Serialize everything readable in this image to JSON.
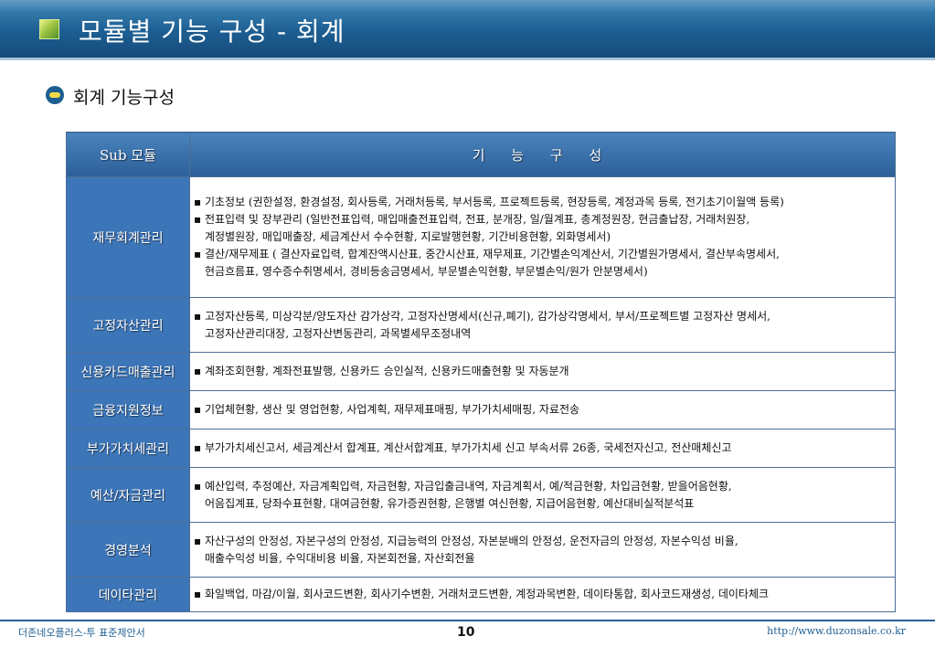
{
  "header": {
    "title": "모듈별 기능 구성 - 회계",
    "icon": "green-square-icon"
  },
  "section": {
    "title": "회계 기능구성",
    "bullet_icon": "oval-bullet-icon"
  },
  "table": {
    "col_module": "Sub 모듈",
    "col_features": "기 능 구 성",
    "rows": [
      {
        "module": "재무회계관리",
        "lines": [
          "▪ 기초정보 (권한설정, 환경설정, 회사등록, 거래처등록, 부서등록, 프로젝트등록, 현장등록, 계정과목 등록, 전기초기이월액 등록)",
          "▪ 전표입력 및 장부관리 (일반전표입력, 매입매출전표입력, 전표, 분개장, 일/월계표, 총계정원장, 현금출납장, 거래처원장,",
          "계정별원장, 매입매출장, 세금계산서 수수현황, 지로발행현황, 기간비용현황, 외화명세서)",
          "▪ 결산/재무제표 ( 결산자료입력, 합계잔액시산표, 중간시산표, 재무제표, 기간별손익계산서, 기간별원가명세서, 결산부속명세서,",
          "현금흐름표, 영수증수취명세서, 경비등송금명세서, 부문별손익현황, 부문별손익/원가 안분명세서)"
        ]
      },
      {
        "module": "고정자산관리",
        "lines": [
          "▪ 고정자산등록, 미상각분/양도자산 감가상각, 고정자산명세서(신규,폐기), 감가상각명세서, 부서/프로젝트별 고정자산 명세서,",
          "고정자산관리대장, 고정자산변동관리, 과목별세무조정내역"
        ]
      },
      {
        "module": "신용카드매출관리",
        "lines": [
          "▪ 계좌조회현황, 계좌전표발행, 신용카드 승인실적, 신용카드매출현황 및 자동분개"
        ]
      },
      {
        "module": "금융지원정보",
        "lines": [
          "▪ 기업체현황, 생산 및 영업현황, 사업계획, 재무제표매핑, 부가가치세매핑, 자료전송"
        ]
      },
      {
        "module": "부가가치세관리",
        "lines": [
          "▪ 부가가치세신고서, 세금계산서 합계표, 계산서합계표, 부가가치세 신고 부속서류 26종, 국세전자신고, 전산매체신고"
        ]
      },
      {
        "module": "예산/자금관리",
        "lines": [
          "▪ 예산입력, 추정예산, 자금계획입력, 자금현황, 자금입출금내역, 자금계획서, 예/적금현황, 차입금현황, 받을어음현황,",
          "어음집계표, 당좌수표현황, 대여금현황, 유가증권현황, 은행별 여신현황, 지급어음현황, 예산대비실적분석표"
        ]
      },
      {
        "module": "경영분석",
        "lines": [
          "▪ 자산구성의 안정성, 자본구성의 안정성, 지급능력의 안정성, 자본분배의 안정성, 운전자금의 안정성, 자본수익성 비율,",
          "매출수익성 비율, 수익대비용 비율, 자본회전율, 자산회전율"
        ]
      },
      {
        "module": "데이타관리",
        "lines": [
          "▪ 화일백업, 마감/이월, 회사코드변환, 회사기수변환, 거래처코드변환, 계정과목변환, 데이타통합, 회사코드재생성, 데이타체크"
        ]
      }
    ]
  },
  "footer": {
    "left": "더존네오플러스-투 표준제안서",
    "page": "10",
    "right": "http://www.duzonsale.co.kr"
  }
}
